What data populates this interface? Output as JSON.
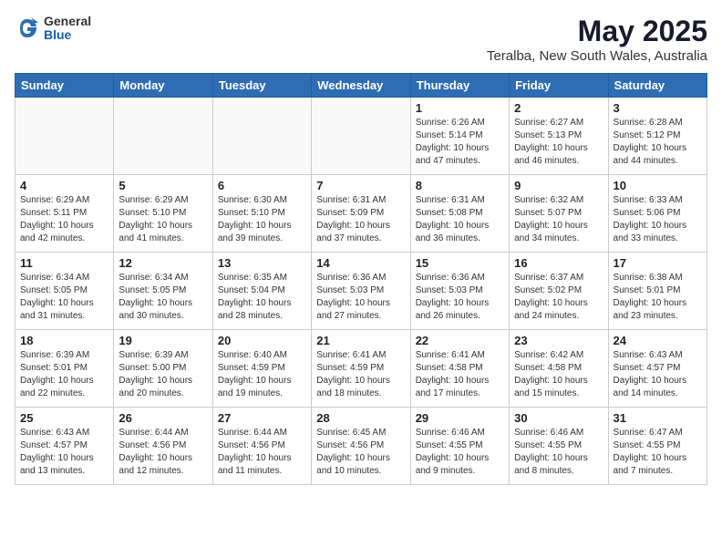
{
  "header": {
    "logo": {
      "general": "General",
      "blue": "Blue"
    },
    "month_title": "May 2025",
    "location": "Teralba, New South Wales, Australia"
  },
  "weekdays": [
    "Sunday",
    "Monday",
    "Tuesday",
    "Wednesday",
    "Thursday",
    "Friday",
    "Saturday"
  ],
  "weeks": [
    [
      {
        "day": "",
        "info": ""
      },
      {
        "day": "",
        "info": ""
      },
      {
        "day": "",
        "info": ""
      },
      {
        "day": "",
        "info": ""
      },
      {
        "day": "1",
        "info": "Sunrise: 6:26 AM\nSunset: 5:14 PM\nDaylight: 10 hours\nand 47 minutes."
      },
      {
        "day": "2",
        "info": "Sunrise: 6:27 AM\nSunset: 5:13 PM\nDaylight: 10 hours\nand 46 minutes."
      },
      {
        "day": "3",
        "info": "Sunrise: 6:28 AM\nSunset: 5:12 PM\nDaylight: 10 hours\nand 44 minutes."
      }
    ],
    [
      {
        "day": "4",
        "info": "Sunrise: 6:29 AM\nSunset: 5:11 PM\nDaylight: 10 hours\nand 42 minutes."
      },
      {
        "day": "5",
        "info": "Sunrise: 6:29 AM\nSunset: 5:10 PM\nDaylight: 10 hours\nand 41 minutes."
      },
      {
        "day": "6",
        "info": "Sunrise: 6:30 AM\nSunset: 5:10 PM\nDaylight: 10 hours\nand 39 minutes."
      },
      {
        "day": "7",
        "info": "Sunrise: 6:31 AM\nSunset: 5:09 PM\nDaylight: 10 hours\nand 37 minutes."
      },
      {
        "day": "8",
        "info": "Sunrise: 6:31 AM\nSunset: 5:08 PM\nDaylight: 10 hours\nand 36 minutes."
      },
      {
        "day": "9",
        "info": "Sunrise: 6:32 AM\nSunset: 5:07 PM\nDaylight: 10 hours\nand 34 minutes."
      },
      {
        "day": "10",
        "info": "Sunrise: 6:33 AM\nSunset: 5:06 PM\nDaylight: 10 hours\nand 33 minutes."
      }
    ],
    [
      {
        "day": "11",
        "info": "Sunrise: 6:34 AM\nSunset: 5:05 PM\nDaylight: 10 hours\nand 31 minutes."
      },
      {
        "day": "12",
        "info": "Sunrise: 6:34 AM\nSunset: 5:05 PM\nDaylight: 10 hours\nand 30 minutes."
      },
      {
        "day": "13",
        "info": "Sunrise: 6:35 AM\nSunset: 5:04 PM\nDaylight: 10 hours\nand 28 minutes."
      },
      {
        "day": "14",
        "info": "Sunrise: 6:36 AM\nSunset: 5:03 PM\nDaylight: 10 hours\nand 27 minutes."
      },
      {
        "day": "15",
        "info": "Sunrise: 6:36 AM\nSunset: 5:03 PM\nDaylight: 10 hours\nand 26 minutes."
      },
      {
        "day": "16",
        "info": "Sunrise: 6:37 AM\nSunset: 5:02 PM\nDaylight: 10 hours\nand 24 minutes."
      },
      {
        "day": "17",
        "info": "Sunrise: 6:38 AM\nSunset: 5:01 PM\nDaylight: 10 hours\nand 23 minutes."
      }
    ],
    [
      {
        "day": "18",
        "info": "Sunrise: 6:39 AM\nSunset: 5:01 PM\nDaylight: 10 hours\nand 22 minutes."
      },
      {
        "day": "19",
        "info": "Sunrise: 6:39 AM\nSunset: 5:00 PM\nDaylight: 10 hours\nand 20 minutes."
      },
      {
        "day": "20",
        "info": "Sunrise: 6:40 AM\nSunset: 4:59 PM\nDaylight: 10 hours\nand 19 minutes."
      },
      {
        "day": "21",
        "info": "Sunrise: 6:41 AM\nSunset: 4:59 PM\nDaylight: 10 hours\nand 18 minutes."
      },
      {
        "day": "22",
        "info": "Sunrise: 6:41 AM\nSunset: 4:58 PM\nDaylight: 10 hours\nand 17 minutes."
      },
      {
        "day": "23",
        "info": "Sunrise: 6:42 AM\nSunset: 4:58 PM\nDaylight: 10 hours\nand 15 minutes."
      },
      {
        "day": "24",
        "info": "Sunrise: 6:43 AM\nSunset: 4:57 PM\nDaylight: 10 hours\nand 14 minutes."
      }
    ],
    [
      {
        "day": "25",
        "info": "Sunrise: 6:43 AM\nSunset: 4:57 PM\nDaylight: 10 hours\nand 13 minutes."
      },
      {
        "day": "26",
        "info": "Sunrise: 6:44 AM\nSunset: 4:56 PM\nDaylight: 10 hours\nand 12 minutes."
      },
      {
        "day": "27",
        "info": "Sunrise: 6:44 AM\nSunset: 4:56 PM\nDaylight: 10 hours\nand 11 minutes."
      },
      {
        "day": "28",
        "info": "Sunrise: 6:45 AM\nSunset: 4:56 PM\nDaylight: 10 hours\nand 10 minutes."
      },
      {
        "day": "29",
        "info": "Sunrise: 6:46 AM\nSunset: 4:55 PM\nDaylight: 10 hours\nand 9 minutes."
      },
      {
        "day": "30",
        "info": "Sunrise: 6:46 AM\nSunset: 4:55 PM\nDaylight: 10 hours\nand 8 minutes."
      },
      {
        "day": "31",
        "info": "Sunrise: 6:47 AM\nSunset: 4:55 PM\nDaylight: 10 hours\nand 7 minutes."
      }
    ]
  ]
}
